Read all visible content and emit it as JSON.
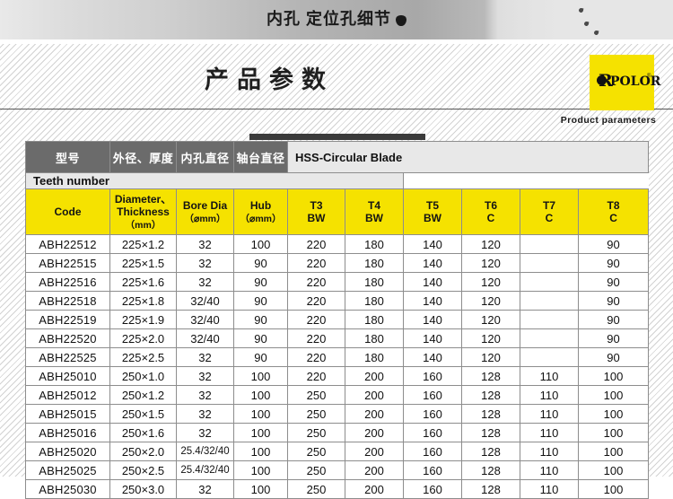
{
  "banner": {
    "title": "内孔 定位孔细节",
    "drop_icon": "droplet-icon"
  },
  "section": {
    "title": "产品参数",
    "caption_en": "Product parameters"
  },
  "logo": {
    "word": "POLOR",
    "reg": "®",
    "letter": "R",
    "bg_color": "#f5e200"
  },
  "table": {
    "header_cn": {
      "code": "型号",
      "diameter_thickness": "外径、厚度",
      "bore": "内孔直径",
      "hub": "轴台直径"
    },
    "group_titles": {
      "hss": "HSS-Circular Blade",
      "teeth": "Teeth number"
    },
    "header_en": [
      {
        "main": "Code",
        "sub": ""
      },
      {
        "main": "Diameter、",
        "main2": "Thickness",
        "sub": "（mm）"
      },
      {
        "main": "Bore Dia",
        "sub": "（⌀mm）"
      },
      {
        "main": "Hub",
        "sub": "（⌀mm）"
      },
      {
        "main": "T3",
        "sub2": "BW"
      },
      {
        "main": "T4",
        "sub2": "BW"
      },
      {
        "main": "T5",
        "sub2": "BW"
      },
      {
        "main": "T6",
        "sub2": "C"
      },
      {
        "main": "T7",
        "sub2": "C"
      },
      {
        "main": "T8",
        "sub2": "C"
      }
    ],
    "rows": [
      {
        "code": "ABH22512",
        "dim": "225×1.2",
        "bore": "32",
        "hub": "100",
        "t3": "220",
        "t4": "180",
        "t5": "140",
        "t6": "120",
        "t7": "",
        "t8": "90"
      },
      {
        "code": "ABH22515",
        "dim": "225×1.5",
        "bore": "32",
        "hub": "90",
        "t3": "220",
        "t4": "180",
        "t5": "140",
        "t6": "120",
        "t7": "",
        "t8": "90"
      },
      {
        "code": "ABH22516",
        "dim": "225×1.6",
        "bore": "32",
        "hub": "90",
        "t3": "220",
        "t4": "180",
        "t5": "140",
        "t6": "120",
        "t7": "",
        "t8": "90"
      },
      {
        "code": "ABH22518",
        "dim": "225×1.8",
        "bore": "32/40",
        "hub": "90",
        "t3": "220",
        "t4": "180",
        "t5": "140",
        "t6": "120",
        "t7": "",
        "t8": "90"
      },
      {
        "code": "ABH22519",
        "dim": "225×1.9",
        "bore": "32/40",
        "hub": "90",
        "t3": "220",
        "t4": "180",
        "t5": "140",
        "t6": "120",
        "t7": "",
        "t8": "90"
      },
      {
        "code": "ABH22520",
        "dim": "225×2.0",
        "bore": "32/40",
        "hub": "90",
        "t3": "220",
        "t4": "180",
        "t5": "140",
        "t6": "120",
        "t7": "",
        "t8": "90"
      },
      {
        "code": "ABH22525",
        "dim": "225×2.5",
        "bore": "32",
        "hub": "90",
        "t3": "220",
        "t4": "180",
        "t5": "140",
        "t6": "120",
        "t7": "",
        "t8": "90"
      },
      {
        "code": "ABH25010",
        "dim": "250×1.0",
        "bore": "32",
        "hub": "100",
        "t3": "220",
        "t4": "200",
        "t5": "160",
        "t6": "128",
        "t7": "110",
        "t8": "100"
      },
      {
        "code": "ABH25012",
        "dim": "250×1.2",
        "bore": "32",
        "hub": "100",
        "t3": "250",
        "t4": "200",
        "t5": "160",
        "t6": "128",
        "t7": "110",
        "t8": "100"
      },
      {
        "code": "ABH25015",
        "dim": "250×1.5",
        "bore": "32",
        "hub": "100",
        "t3": "250",
        "t4": "200",
        "t5": "160",
        "t6": "128",
        "t7": "110",
        "t8": "100"
      },
      {
        "code": "ABH25016",
        "dim": "250×1.6",
        "bore": "32",
        "hub": "100",
        "t3": "250",
        "t4": "200",
        "t5": "160",
        "t6": "128",
        "t7": "110",
        "t8": "100"
      },
      {
        "code": "ABH25020",
        "dim": "250×2.0",
        "bore": "25.4/32/40",
        "hub": "100",
        "t3": "250",
        "t4": "200",
        "t5": "160",
        "t6": "128",
        "t7": "110",
        "t8": "100"
      },
      {
        "code": "ABH25025",
        "dim": "250×2.5",
        "bore": "25.4/32/40",
        "hub": "100",
        "t3": "250",
        "t4": "200",
        "t5": "160",
        "t6": "128",
        "t7": "110",
        "t8": "100"
      },
      {
        "code": "ABH25030",
        "dim": "250×3.0",
        "bore": "32",
        "hub": "100",
        "t3": "250",
        "t4": "200",
        "t5": "160",
        "t6": "128",
        "t7": "110",
        "t8": "100"
      }
    ]
  }
}
